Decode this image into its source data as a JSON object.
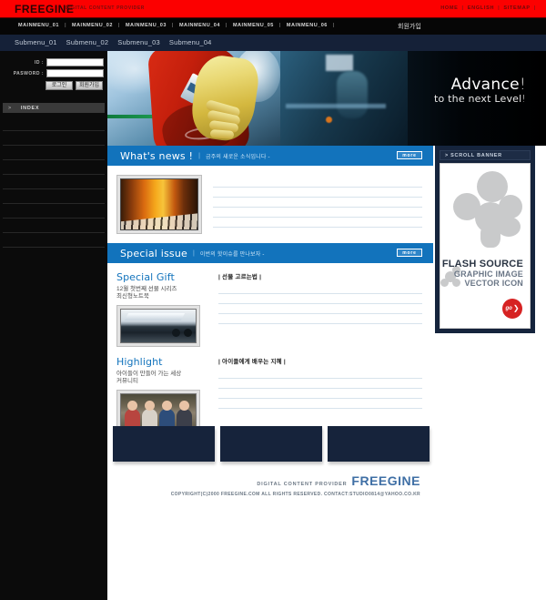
{
  "header": {
    "logo": "FREEGINE",
    "logo_tagline": "DIGITAL CONTENT PROVIDER",
    "top_links": [
      "HOME",
      "ENGLISH",
      "SITEMAP"
    ],
    "separator": "|"
  },
  "mainmenu": {
    "items": [
      "MAINMENU_01",
      "MAINMENU_02",
      "MAINMENU_03",
      "MAINMENU_04",
      "MAINMENU_05",
      "MAINMENU_06"
    ],
    "separator": "|",
    "join_label": "회원가입"
  },
  "submenu": {
    "items": [
      "Submenu_01",
      "Submenu_02",
      "Submenu_03",
      "Submenu_04"
    ]
  },
  "sidebar": {
    "login": {
      "id_label": "ID :",
      "id_value": "",
      "id_placeholder": "",
      "password_label": "PASWORD :",
      "password_value": "",
      "password_placeholder": "",
      "login_button": "로그인",
      "join_button": "회원가입"
    },
    "index": {
      "arrow": ">",
      "label": "INDEX"
    },
    "rows": [
      "",
      "",
      "",
      "",
      "",
      "",
      "",
      "",
      ""
    ]
  },
  "hero": {
    "line1": "Advance",
    "bang1": "!",
    "line2": "to the next Level",
    "bang2": "!"
  },
  "news": {
    "title": "What's news !",
    "bar": "|",
    "subtitle": "금주의 새로운 소식입니다 -",
    "more": "more",
    "thumb_name": "piano-keyboard-photo",
    "lines": [
      "",
      "",
      "",
      "",
      ""
    ]
  },
  "special": {
    "title": "Special issue",
    "bar": "|",
    "subtitle": "이번의 핫이슈를 만나보자 -",
    "more": "more",
    "gift": {
      "title": "Special Gift",
      "desc_line1": "12월 첫번째 선물 시리즈",
      "desc_line2": "최신형노트북",
      "thumb_name": "laptop-photo",
      "caption": "| 선물 고르는법 |",
      "lines": [
        "",
        "",
        "",
        ""
      ]
    },
    "highlight": {
      "title": "Highlight",
      "desc_line1": "아이들이 만들어 가는 세상",
      "desc_line2": "커뮤니티",
      "thumb_name": "children-photo",
      "caption": "| 아이들에게 배우는 지혜 |",
      "lines": [
        "",
        "",
        "",
        ""
      ]
    }
  },
  "banners": [
    {
      "label": ""
    },
    {
      "label": ""
    },
    {
      "label": ""
    }
  ],
  "footer": {
    "provider": "DIGITAL CONTENT  PROVIDER",
    "brand": "FREEGINE",
    "copyright": "COPYRIGHT(C)2000 FREEGINE.COM ALL RIGHTS RESERVED. CONTACT:STUDIO0814@YAHOO.CO.KR"
  },
  "scroll_banner": {
    "head_arrow": ">",
    "head_label": "SCROLL BANNER",
    "title": "FLASH SOURCE",
    "line2": "GRAPHIC IMAGE",
    "line3": "VECTOR ICON",
    "go_label": "go",
    "go_arrow": "❯"
  },
  "colors": {
    "brand_red": "#fc0000",
    "menu_black": "#060606",
    "submenu_navy": "#152138",
    "section_blue": "#1273bc",
    "accent_link": "#1273bc",
    "banner_navy": "#16233b",
    "go_red": "#d62222"
  }
}
